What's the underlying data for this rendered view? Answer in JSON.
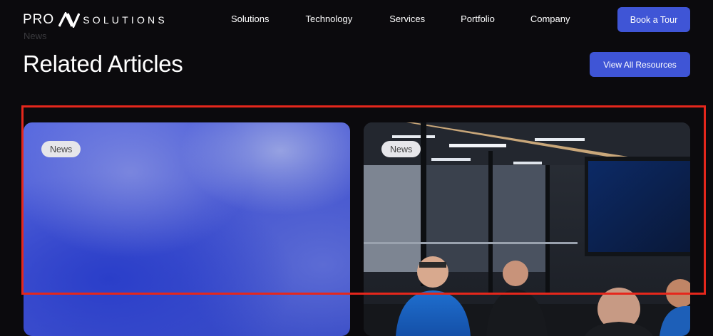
{
  "header": {
    "logo": {
      "prefix": "PRO",
      "mark": "AV",
      "suffix": "SOLUTIONS"
    },
    "nav": [
      "Solutions",
      "Technology",
      "Services",
      "Portfolio",
      "Company"
    ],
    "cta": "Book a Tour"
  },
  "section": {
    "eyebrow": "News",
    "title": "Related Articles",
    "view_all": "View All Resources"
  },
  "articles": [
    {
      "tag": "News",
      "image": "blue-gradient"
    },
    {
      "tag": "News",
      "image": "meeting-room-photo"
    }
  ],
  "colors": {
    "background": "#0b0a0d",
    "accent": "#3f55d6",
    "highlight": "#e5271c"
  }
}
